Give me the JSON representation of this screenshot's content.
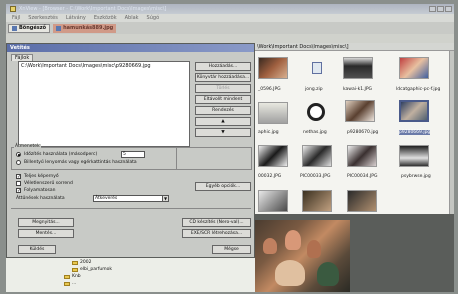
{
  "window": {
    "title": "XnView - [Browser - C:\\Work\\Important Docs\\Images\\misc\\]",
    "menu": [
      "Fájl",
      "Szerkesztés",
      "Látvány",
      "Eszközök",
      "Ablak",
      "Súgó"
    ]
  },
  "tabs": [
    {
      "label": "Böngésző",
      "active": true
    },
    {
      "label": "hamunkás889.jpg",
      "active": false
    }
  ],
  "browser": {
    "path": "\\Work\\Important Docs\\Images\\misc\\]",
    "thumbnails": [
      {
        "label": "_0596.JPG"
      },
      {
        "label": "jong.zip"
      },
      {
        "label": "kawai-k1.JPG"
      },
      {
        "label": "ldcatgaphic-pc-f.jpg"
      },
      {
        "label": "aphic.jpg"
      },
      {
        "label": "nethas.jpg"
      },
      {
        "label": "p9280670.jpg"
      },
      {
        "label": "p9280669.jpg"
      },
      {
        "label": "00032.JPG"
      },
      {
        "label": "PIC00033.JPG"
      },
      {
        "label": "PIC00034.JPG"
      },
      {
        "label": "psybrwse.jpg"
      }
    ]
  },
  "dialog": {
    "title": "Vetítés",
    "tab": "Fájlok",
    "files": [
      "C:\\Work\\Important Docs\\Images\\misc\\p9280669.jpg"
    ],
    "buttons": {
      "add": "Hozzáadás...",
      "add_folder": "Könyvtár hozzáadása...",
      "delete": "Törlés",
      "remove_all": "Eltávolít mindent",
      "sort": "Rendezés",
      "up": "▲",
      "down": "▼",
      "other_options": "Egyéb opciók...",
      "open": "Megnyitás...",
      "save": "Mentés...",
      "cd_create": "CD készítés (Nero-val)...",
      "exe_create": "EXE/SCR létrehozása...",
      "start": "Küldés",
      "cancel": "Mégse"
    },
    "transition_group": {
      "label": "Átmenetek",
      "radio_timer": "Időzítés használata (másodperc)",
      "radio_timer_value": "5",
      "radio_key": "Billentyű lenyomás vagy egérkattintás használata"
    },
    "checkboxes": [
      {
        "label": "Teljes képernyő",
        "checked": true
      },
      {
        "label": "Véletlenszerű sorrend",
        "checked": false
      },
      {
        "label": "Folyamatosan",
        "checked": true
      }
    ],
    "transition_effect": {
      "label": "Áttűnések használata",
      "value": "Átkeverés"
    }
  },
  "tree": {
    "items": [
      "2002",
      "elbi_parfumok",
      "Knb",
      "..."
    ]
  }
}
